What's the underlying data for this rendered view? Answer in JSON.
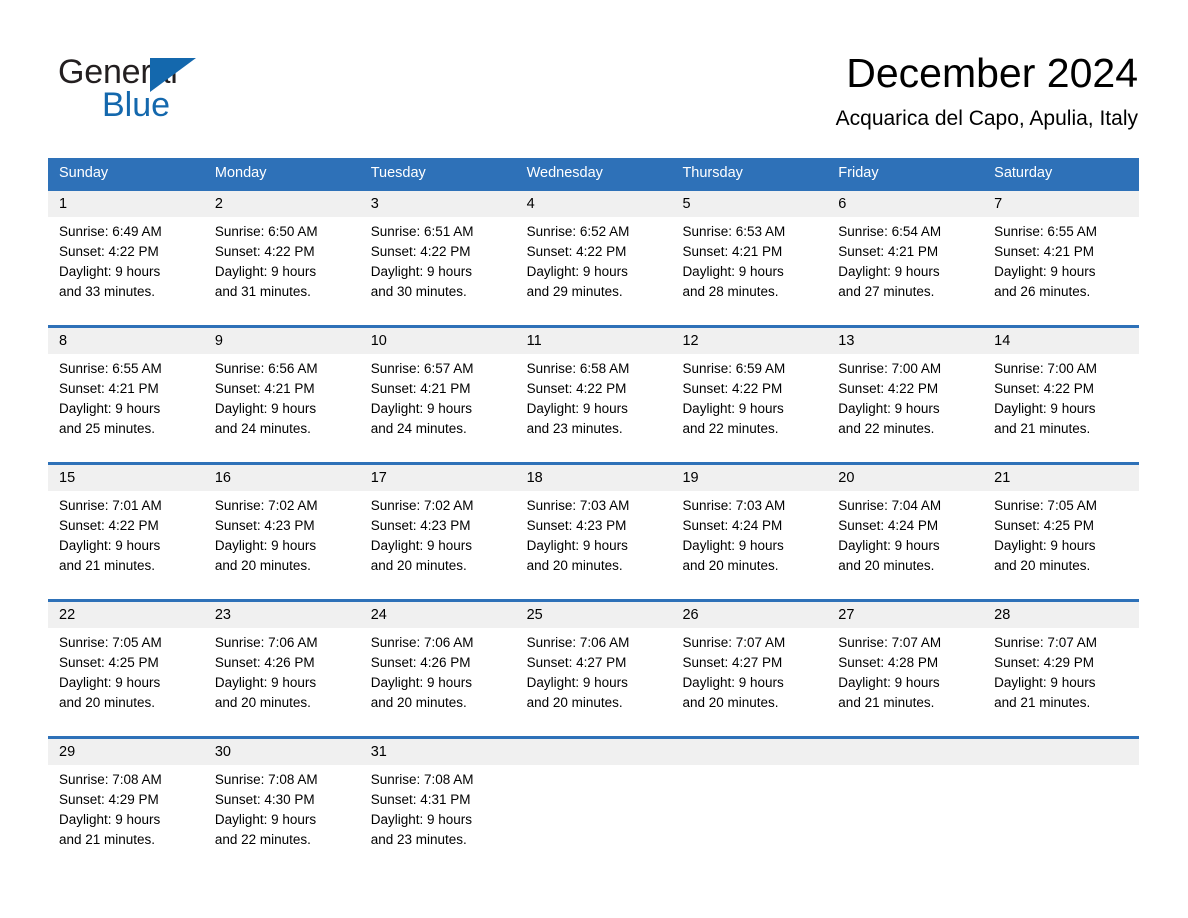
{
  "brand": {
    "name_part1": "General",
    "name_part2": "Blue",
    "accent_color": "#1468ad",
    "triangle_icon": "triangle-icon"
  },
  "header": {
    "title": "December 2024",
    "subtitle": "Acquarica del Capo, Apulia, Italy"
  },
  "theme": {
    "header_blue": "#2e71b8",
    "date_bar_gray": "#f0f0f0",
    "text_black": "#000000"
  },
  "weekdays": [
    "Sunday",
    "Monday",
    "Tuesday",
    "Wednesday",
    "Thursday",
    "Friday",
    "Saturday"
  ],
  "weeks": [
    {
      "dates": [
        "1",
        "2",
        "3",
        "4",
        "5",
        "6",
        "7"
      ],
      "cells": [
        {
          "sunrise": "Sunrise: 6:49 AM",
          "sunset": "Sunset: 4:22 PM",
          "daylight1": "Daylight: 9 hours",
          "daylight2": "and 33 minutes."
        },
        {
          "sunrise": "Sunrise: 6:50 AM",
          "sunset": "Sunset: 4:22 PM",
          "daylight1": "Daylight: 9 hours",
          "daylight2": "and 31 minutes."
        },
        {
          "sunrise": "Sunrise: 6:51 AM",
          "sunset": "Sunset: 4:22 PM",
          "daylight1": "Daylight: 9 hours",
          "daylight2": "and 30 minutes."
        },
        {
          "sunrise": "Sunrise: 6:52 AM",
          "sunset": "Sunset: 4:22 PM",
          "daylight1": "Daylight: 9 hours",
          "daylight2": "and 29 minutes."
        },
        {
          "sunrise": "Sunrise: 6:53 AM",
          "sunset": "Sunset: 4:21 PM",
          "daylight1": "Daylight: 9 hours",
          "daylight2": "and 28 minutes."
        },
        {
          "sunrise": "Sunrise: 6:54 AM",
          "sunset": "Sunset: 4:21 PM",
          "daylight1": "Daylight: 9 hours",
          "daylight2": "and 27 minutes."
        },
        {
          "sunrise": "Sunrise: 6:55 AM",
          "sunset": "Sunset: 4:21 PM",
          "daylight1": "Daylight: 9 hours",
          "daylight2": "and 26 minutes."
        }
      ]
    },
    {
      "dates": [
        "8",
        "9",
        "10",
        "11",
        "12",
        "13",
        "14"
      ],
      "cells": [
        {
          "sunrise": "Sunrise: 6:55 AM",
          "sunset": "Sunset: 4:21 PM",
          "daylight1": "Daylight: 9 hours",
          "daylight2": "and 25 minutes."
        },
        {
          "sunrise": "Sunrise: 6:56 AM",
          "sunset": "Sunset: 4:21 PM",
          "daylight1": "Daylight: 9 hours",
          "daylight2": "and 24 minutes."
        },
        {
          "sunrise": "Sunrise: 6:57 AM",
          "sunset": "Sunset: 4:21 PM",
          "daylight1": "Daylight: 9 hours",
          "daylight2": "and 24 minutes."
        },
        {
          "sunrise": "Sunrise: 6:58 AM",
          "sunset": "Sunset: 4:22 PM",
          "daylight1": "Daylight: 9 hours",
          "daylight2": "and 23 minutes."
        },
        {
          "sunrise": "Sunrise: 6:59 AM",
          "sunset": "Sunset: 4:22 PM",
          "daylight1": "Daylight: 9 hours",
          "daylight2": "and 22 minutes."
        },
        {
          "sunrise": "Sunrise: 7:00 AM",
          "sunset": "Sunset: 4:22 PM",
          "daylight1": "Daylight: 9 hours",
          "daylight2": "and 22 minutes."
        },
        {
          "sunrise": "Sunrise: 7:00 AM",
          "sunset": "Sunset: 4:22 PM",
          "daylight1": "Daylight: 9 hours",
          "daylight2": "and 21 minutes."
        }
      ]
    },
    {
      "dates": [
        "15",
        "16",
        "17",
        "18",
        "19",
        "20",
        "21"
      ],
      "cells": [
        {
          "sunrise": "Sunrise: 7:01 AM",
          "sunset": "Sunset: 4:22 PM",
          "daylight1": "Daylight: 9 hours",
          "daylight2": "and 21 minutes."
        },
        {
          "sunrise": "Sunrise: 7:02 AM",
          "sunset": "Sunset: 4:23 PM",
          "daylight1": "Daylight: 9 hours",
          "daylight2": "and 20 minutes."
        },
        {
          "sunrise": "Sunrise: 7:02 AM",
          "sunset": "Sunset: 4:23 PM",
          "daylight1": "Daylight: 9 hours",
          "daylight2": "and 20 minutes."
        },
        {
          "sunrise": "Sunrise: 7:03 AM",
          "sunset": "Sunset: 4:23 PM",
          "daylight1": "Daylight: 9 hours",
          "daylight2": "and 20 minutes."
        },
        {
          "sunrise": "Sunrise: 7:03 AM",
          "sunset": "Sunset: 4:24 PM",
          "daylight1": "Daylight: 9 hours",
          "daylight2": "and 20 minutes."
        },
        {
          "sunrise": "Sunrise: 7:04 AM",
          "sunset": "Sunset: 4:24 PM",
          "daylight1": "Daylight: 9 hours",
          "daylight2": "and 20 minutes."
        },
        {
          "sunrise": "Sunrise: 7:05 AM",
          "sunset": "Sunset: 4:25 PM",
          "daylight1": "Daylight: 9 hours",
          "daylight2": "and 20 minutes."
        }
      ]
    },
    {
      "dates": [
        "22",
        "23",
        "24",
        "25",
        "26",
        "27",
        "28"
      ],
      "cells": [
        {
          "sunrise": "Sunrise: 7:05 AM",
          "sunset": "Sunset: 4:25 PM",
          "daylight1": "Daylight: 9 hours",
          "daylight2": "and 20 minutes."
        },
        {
          "sunrise": "Sunrise: 7:06 AM",
          "sunset": "Sunset: 4:26 PM",
          "daylight1": "Daylight: 9 hours",
          "daylight2": "and 20 minutes."
        },
        {
          "sunrise": "Sunrise: 7:06 AM",
          "sunset": "Sunset: 4:26 PM",
          "daylight1": "Daylight: 9 hours",
          "daylight2": "and 20 minutes."
        },
        {
          "sunrise": "Sunrise: 7:06 AM",
          "sunset": "Sunset: 4:27 PM",
          "daylight1": "Daylight: 9 hours",
          "daylight2": "and 20 minutes."
        },
        {
          "sunrise": "Sunrise: 7:07 AM",
          "sunset": "Sunset: 4:27 PM",
          "daylight1": "Daylight: 9 hours",
          "daylight2": "and 20 minutes."
        },
        {
          "sunrise": "Sunrise: 7:07 AM",
          "sunset": "Sunset: 4:28 PM",
          "daylight1": "Daylight: 9 hours",
          "daylight2": "and 21 minutes."
        },
        {
          "sunrise": "Sunrise: 7:07 AM",
          "sunset": "Sunset: 4:29 PM",
          "daylight1": "Daylight: 9 hours",
          "daylight2": "and 21 minutes."
        }
      ]
    },
    {
      "dates": [
        "29",
        "30",
        "31",
        "",
        "",
        "",
        ""
      ],
      "cells": [
        {
          "sunrise": "Sunrise: 7:08 AM",
          "sunset": "Sunset: 4:29 PM",
          "daylight1": "Daylight: 9 hours",
          "daylight2": "and 21 minutes."
        },
        {
          "sunrise": "Sunrise: 7:08 AM",
          "sunset": "Sunset: 4:30 PM",
          "daylight1": "Daylight: 9 hours",
          "daylight2": "and 22 minutes."
        },
        {
          "sunrise": "Sunrise: 7:08 AM",
          "sunset": "Sunset: 4:31 PM",
          "daylight1": "Daylight: 9 hours",
          "daylight2": "and 23 minutes."
        },
        {
          "sunrise": "",
          "sunset": "",
          "daylight1": "",
          "daylight2": ""
        },
        {
          "sunrise": "",
          "sunset": "",
          "daylight1": "",
          "daylight2": ""
        },
        {
          "sunrise": "",
          "sunset": "",
          "daylight1": "",
          "daylight2": ""
        },
        {
          "sunrise": "",
          "sunset": "",
          "daylight1": "",
          "daylight2": ""
        }
      ]
    }
  ]
}
